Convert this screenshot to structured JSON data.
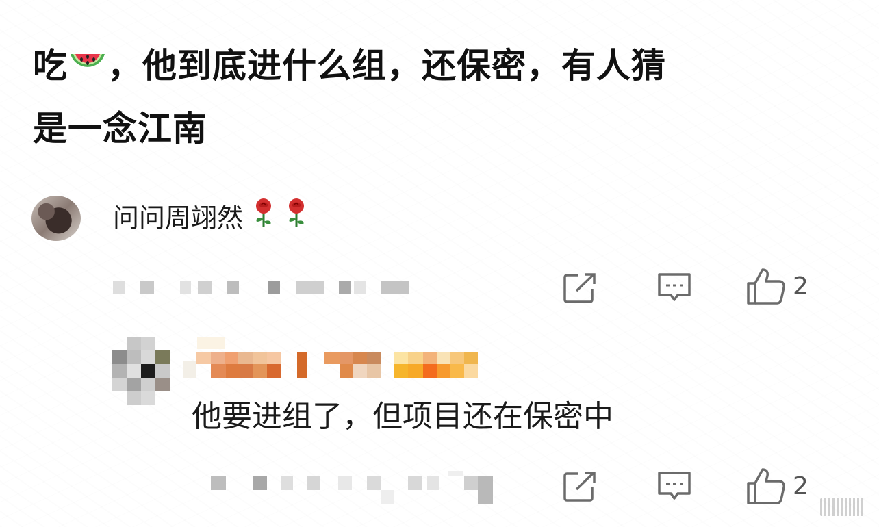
{
  "post": {
    "title_prefix": "吃",
    "title_emoji": "watermelon-icon",
    "title_line1_rest": "，他到底进什么组，还保密，有人猜",
    "title_line2": "是一念江南"
  },
  "comment": {
    "avatar_icon": "user-avatar",
    "text": "问问周翊然",
    "emojis": [
      "rose-icon",
      "rose-icon"
    ],
    "actions": {
      "share_icon": "share-icon",
      "reply_icon": "comment-icon",
      "like_icon": "thumbs-up-icon",
      "like_count": "2"
    }
  },
  "reply": {
    "avatar_icon": "pixelated-avatar",
    "text": "他要进组了，但项目还在保密中",
    "actions": {
      "share_icon": "share-icon",
      "reply_icon": "comment-icon",
      "like_icon": "thumbs-up-icon",
      "like_count": "2"
    }
  },
  "colors": {
    "text": "#111111",
    "icon": "#6b6b6b",
    "blur_gray": "#c8c8c8",
    "blur_orange": "#e08a4a",
    "blur_yellow": "#f6b52c"
  }
}
